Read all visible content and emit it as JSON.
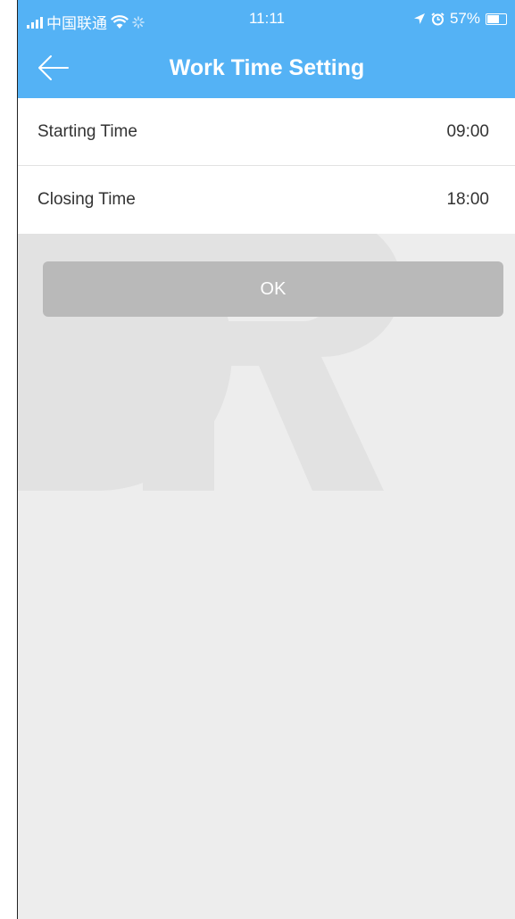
{
  "status_bar": {
    "carrier": "中国联通",
    "time": "11:11",
    "battery": "57%",
    "battery_level": 0.57,
    "icons": [
      "signal-icon",
      "wifi-icon",
      "loading-icon",
      "location-arrow-icon",
      "alarm-icon",
      "battery-icon"
    ]
  },
  "navbar": {
    "title": "Work Time Setting",
    "back_icon": "arrow-left-icon"
  },
  "settings": {
    "rows": [
      {
        "label": "Starting Time",
        "value": "09:00"
      },
      {
        "label": "Closing Time",
        "value": "18:00"
      }
    ]
  },
  "ok_button": {
    "label": "OK"
  },
  "colors": {
    "header": "#54b2f5",
    "background": "#ededed",
    "button": "#b9b9b9",
    "text": "#333333"
  }
}
